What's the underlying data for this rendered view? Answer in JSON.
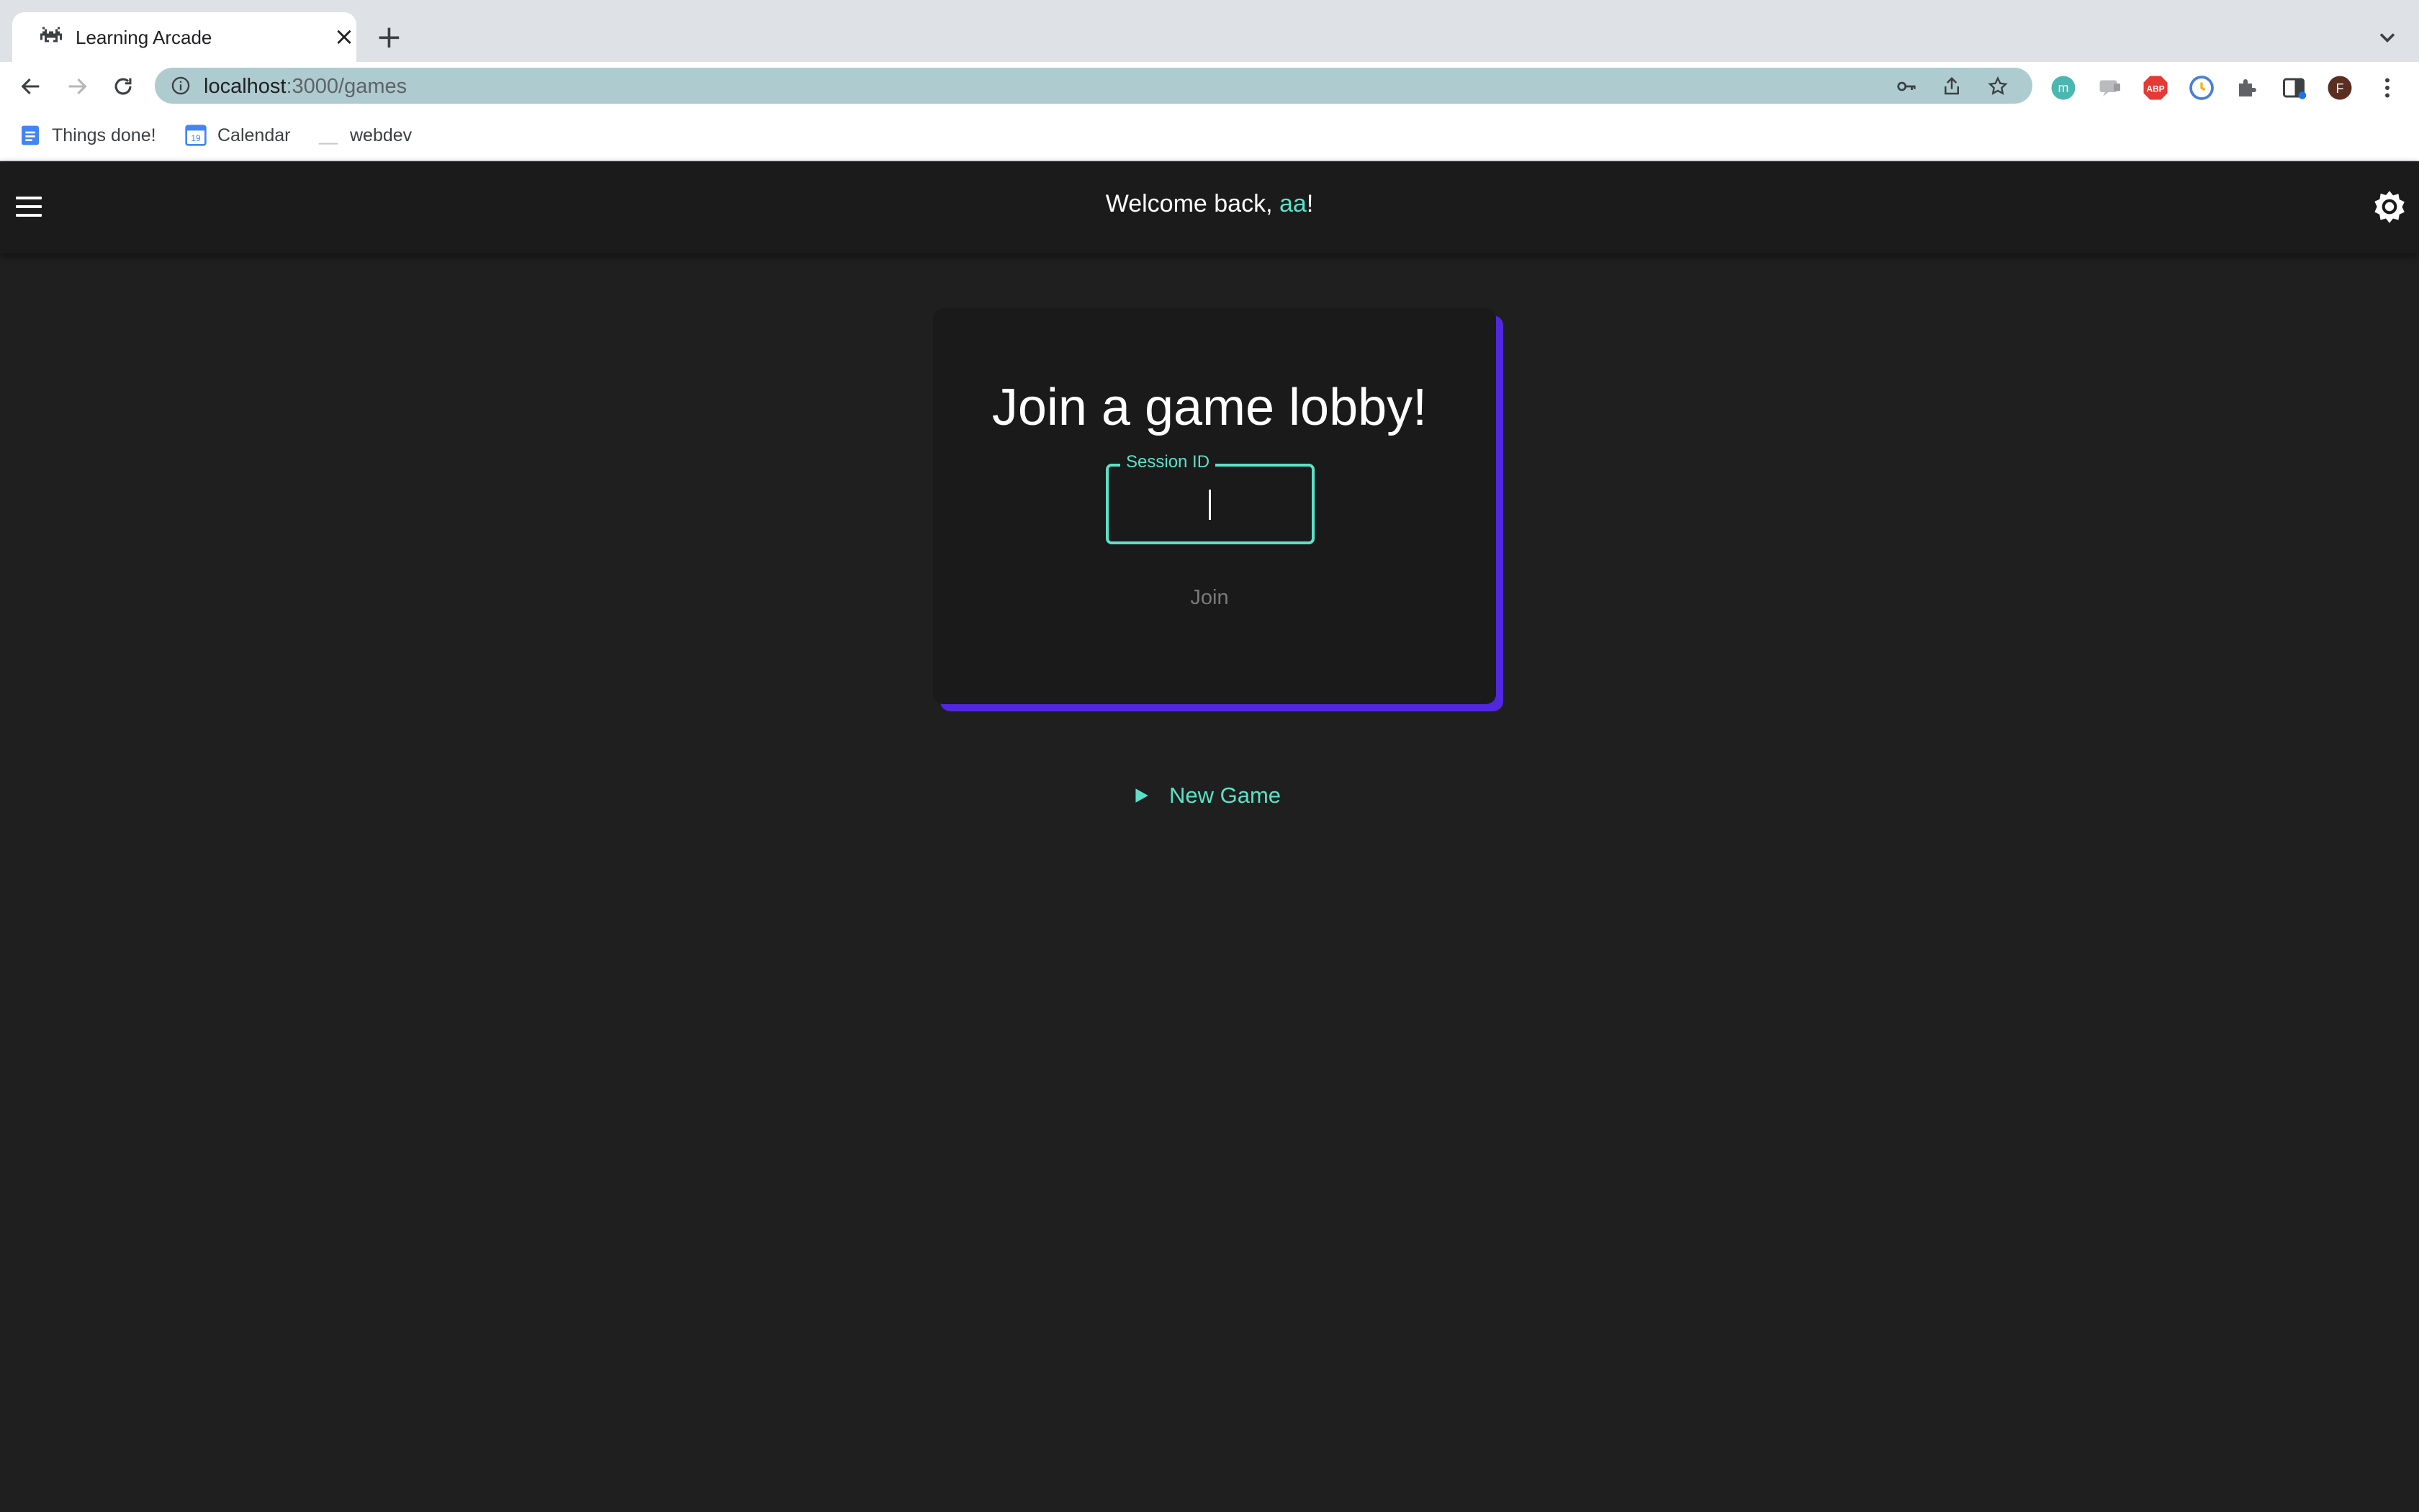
{
  "browser": {
    "tab_title": "Learning Arcade",
    "url_host": "localhost",
    "url_path": ":3000/games",
    "bookmarks": [
      {
        "label": "Things done!"
      },
      {
        "label": "Calendar"
      },
      {
        "label": "webdev"
      }
    ],
    "calendar_day": "19",
    "profile_initial": "F",
    "ext_abp": "ABP",
    "ext_m": "m"
  },
  "app": {
    "welcome_prefix": "Welcome back, ",
    "username": "aa",
    "welcome_suffix": "!",
    "card_title": "Join a game lobby!",
    "session_label": "Session ID",
    "session_value": "",
    "join_label": "Join",
    "new_game_label": "New Game"
  },
  "colors": {
    "accent_teal": "#5ce1c8",
    "accent_purple": "#5227e0",
    "background": "#1f1f1f"
  }
}
